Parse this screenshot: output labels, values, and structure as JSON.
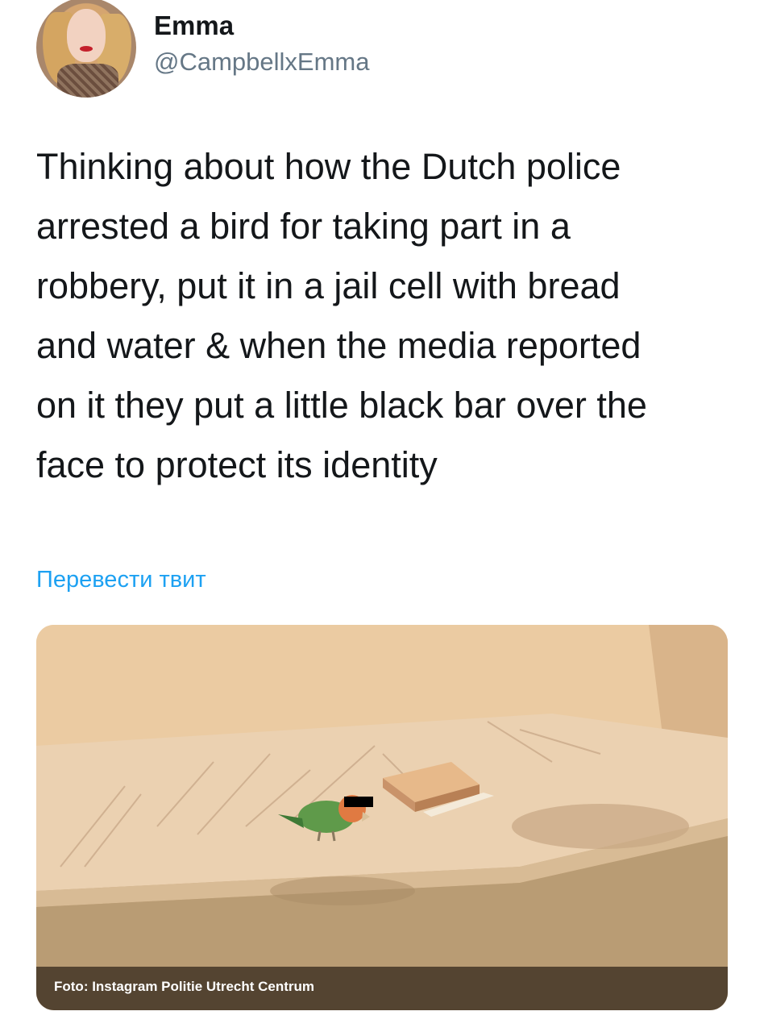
{
  "user": {
    "name": "Emma",
    "handle": "@CampbellxEmma",
    "avatar_icon": "profile-photo"
  },
  "tweet": {
    "text": "Thinking about how the Dutch police\narrested a bird for taking part in a\nrobbery, put it in a jail cell with bread\nand water & when the media reported\non it they put a little black bar over the\nface to protect its identity"
  },
  "translate_link": "Перевести твит",
  "media": {
    "caption": "Foto: Instagram Politie Utrecht Centrum"
  },
  "colors": {
    "link": "#1da1f2",
    "secondary_text": "#657786",
    "primary_text": "#14171a"
  }
}
